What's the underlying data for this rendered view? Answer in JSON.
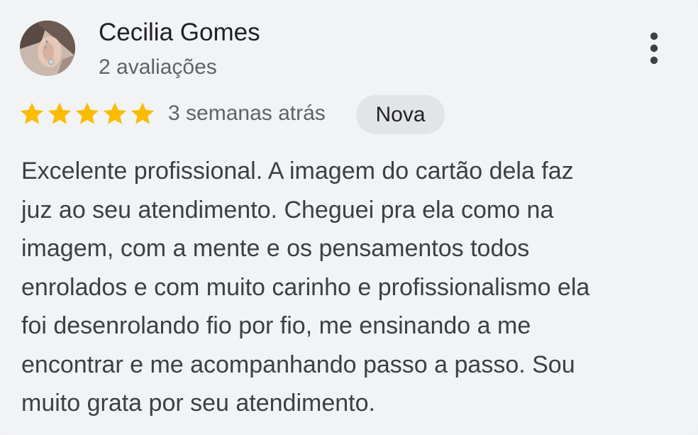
{
  "review": {
    "author_name": "Cecilia Gomes",
    "review_count": "2 avaliações",
    "rating": 5,
    "rating_max": 5,
    "time_ago": "3 semanas atrás",
    "badge": "Nova",
    "text_lines": [
      "Excelente profissional. A imagem do cartão dela faz",
      "juz ao seu atendimento. Cheguei pra ela como na",
      "imagem, com a mente e os pensamentos todos",
      "enrolados e com muito carinho e profissionalismo ela",
      "foi desenrolando fio por fio, me ensinando a me",
      "encontrar e me acompanhando passo a passo. Sou",
      "muito grata por seu atendimento."
    ]
  },
  "icons": {
    "star": "star-icon",
    "more": "more-vert-icon"
  },
  "colors": {
    "star": "#fbbc04",
    "background": "#f2f3f5",
    "badge_bg": "#e3e4e7",
    "primary_text": "#202124",
    "secondary_text": "#5f6368"
  }
}
